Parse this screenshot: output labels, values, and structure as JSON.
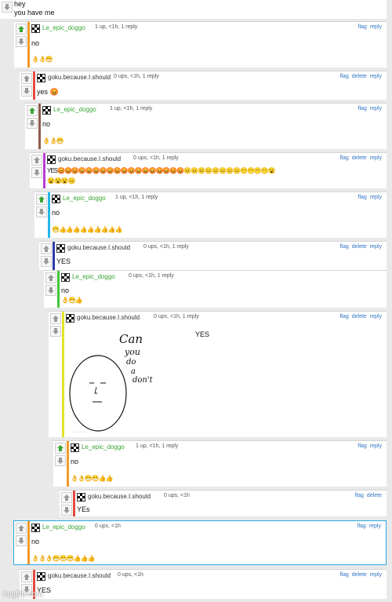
{
  "top": {
    "line1": "hey",
    "line2": "you have me"
  },
  "actions": {
    "flag": "flag",
    "delete": "delete",
    "reply": "reply"
  },
  "colors": {
    "orange": "#f19a2b",
    "red": "#e34b3f",
    "brown": "#8f5b4b",
    "purple": "#b93ed1",
    "cyan": "#25b5e8",
    "blue": "#2e3aa8",
    "green": "#43c63b",
    "yellow": "#e2e22a",
    "link": "#2f75c0"
  },
  "comments": [
    {
      "user": "Le_epic_doggo",
      "meta": "1 up, <1h, 1 reply",
      "text": "no",
      "emoji": "👌👌😁"
    },
    {
      "user": "goku.because.I.should",
      "meta": "0 ups, <1h, 1 reply",
      "text": "yes 😡",
      "emoji": ""
    },
    {
      "user": "Le_epic_doggo",
      "meta": "1 up, <1h, 1 reply",
      "text": "no",
      "emoji": "👌👌😁"
    },
    {
      "user": "goku.because.I.should",
      "meta": "0 ups, <1h, 1 reply",
      "text": "YES😡😡😡😡😡😡😡😡😡😡😡😡😡😡😡😡😡😡😐😐😐😑😑😑😑😑😶😶😶😶😮",
      "emoji": "😮😮😮😑"
    },
    {
      "user": "Le_epic_doggo",
      "meta": "1 up, <1h, 1 reply",
      "text": "no",
      "emoji": "😁👍👍👍👍👍👍👍👍👍"
    },
    {
      "user": "goku.because.I.should",
      "meta": "0 ups, <1h, 1 reply",
      "text": "YES",
      "emoji": ""
    },
    {
      "user": "Le_epic_doggo",
      "meta": "0 ups, <1h, 1 reply",
      "text": "no",
      "emoji": "👌😁👍"
    },
    {
      "user": "goku.because.I.should",
      "meta": "0 ups, <1h, 1 reply",
      "text": "YES",
      "emoji": ""
    },
    {
      "user": "Le_epic_doggo",
      "meta": "1 up, <1h, 1 reply",
      "text": "no",
      "emoji": "👌👌😁😁👍👍"
    },
    {
      "user": "goku.because.I.should",
      "meta": "0 ups, <1h",
      "text": "YEs",
      "emoji": ""
    },
    {
      "user": "Le_epic_doggo",
      "meta": "0 ups, <1h",
      "text": "no",
      "emoji": "👌👌👌😁😁😁👍👍👍"
    },
    {
      "user": "goku.because.I.should",
      "meta": "0 ups, <1h",
      "text": "YES",
      "emoji": ""
    }
  ],
  "drawing": {
    "line1": "Can",
    "line2": "you",
    "line3": "do",
    "line4": "a",
    "line5": "don't"
  },
  "watermark": "imgflip.com"
}
